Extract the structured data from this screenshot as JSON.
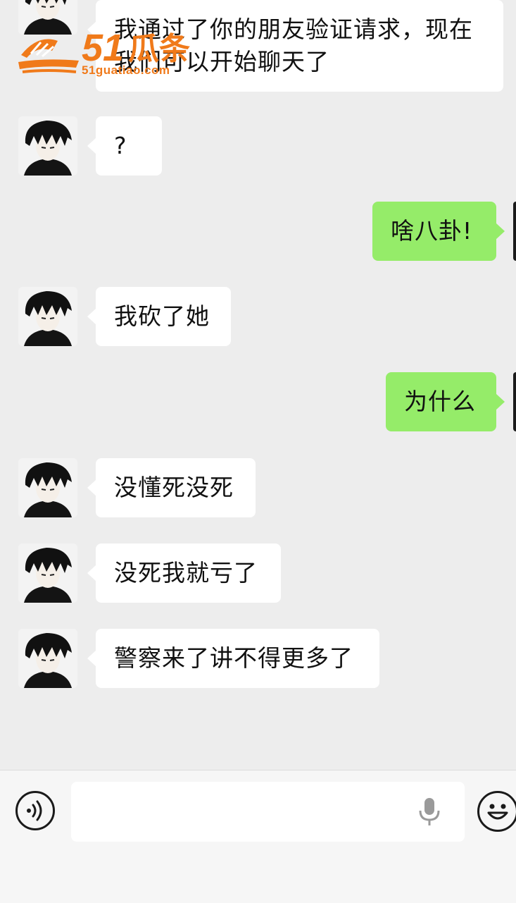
{
  "messages": [
    {
      "from": "other",
      "text": "我通过了你的朋友验证请求，现在我们可以开始聊天了"
    },
    {
      "from": "other",
      "text": "?"
    },
    {
      "from": "self",
      "text": "啥八卦!"
    },
    {
      "from": "other",
      "text": "我砍了她"
    },
    {
      "from": "self",
      "text": "为什么"
    },
    {
      "from": "other",
      "text": "没懂死没死"
    },
    {
      "from": "other",
      "text": "没死我就亏了"
    },
    {
      "from": "other",
      "text": "警察来了讲不得更多了"
    }
  ],
  "watermark": {
    "number": "51",
    "name": "瓜条",
    "url": "51guatiao.com"
  },
  "input_bar": {
    "text_value": "",
    "placeholder": ""
  },
  "colors": {
    "background": "#ededed",
    "incoming_bubble": "#ffffff",
    "outgoing_bubble": "#95ec69",
    "accent": "#f07a1a"
  },
  "icons": {
    "voice": "voice-icon",
    "mic": "microphone-icon",
    "emoji": "emoji-icon",
    "avatar": "anime-boy-avatar"
  }
}
